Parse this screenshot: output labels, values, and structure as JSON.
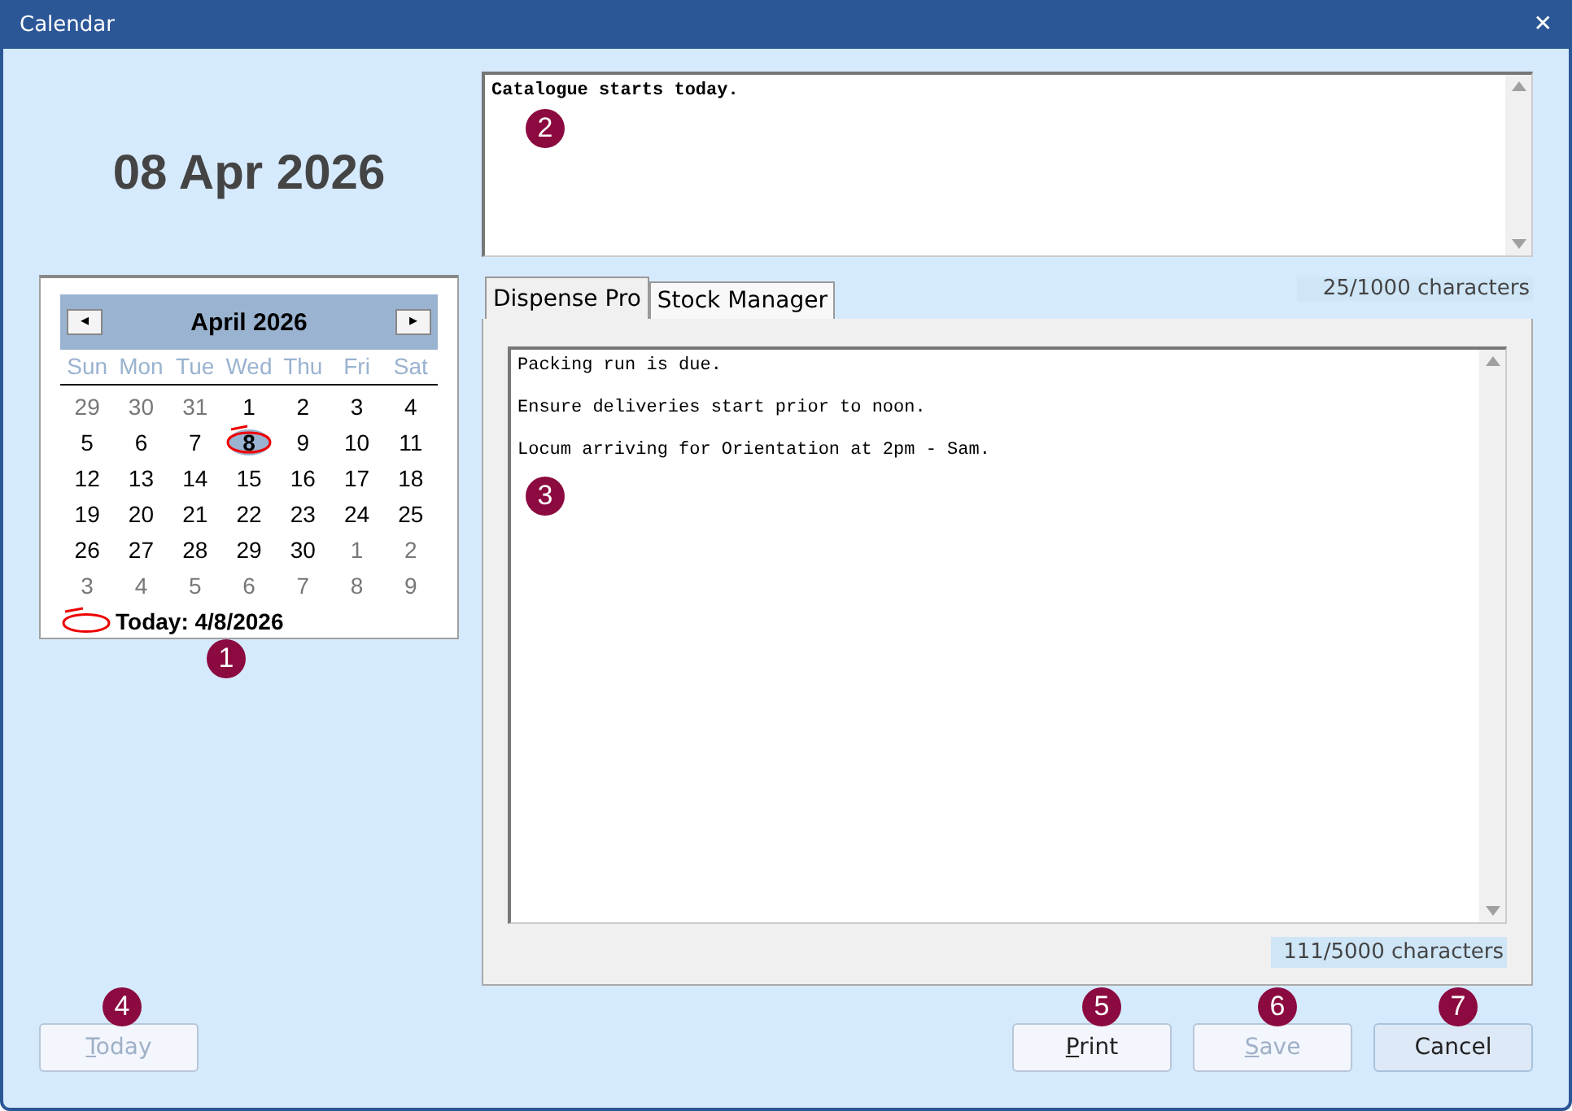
{
  "window": {
    "title": "Calendar",
    "close": "✕"
  },
  "date_heading": "08 Apr 2026",
  "calendar": {
    "month_label": "April 2026",
    "prev": "◂",
    "next": "▸",
    "weekdays": [
      "Sun",
      "Mon",
      "Tue",
      "Wed",
      "Thu",
      "Fri",
      "Sat"
    ],
    "weeks": [
      [
        {
          "day": "29",
          "other_month": true,
          "selected": false
        },
        {
          "day": "30",
          "other_month": true,
          "selected": false
        },
        {
          "day": "31",
          "other_month": true,
          "selected": false
        },
        {
          "day": "1",
          "other_month": false,
          "selected": false
        },
        {
          "day": "2",
          "other_month": false,
          "selected": false
        },
        {
          "day": "3",
          "other_month": false,
          "selected": false
        },
        {
          "day": "4",
          "other_month": false,
          "selected": false
        }
      ],
      [
        {
          "day": "5",
          "other_month": false,
          "selected": false
        },
        {
          "day": "6",
          "other_month": false,
          "selected": false
        },
        {
          "day": "7",
          "other_month": false,
          "selected": false
        },
        {
          "day": "8",
          "other_month": false,
          "selected": true
        },
        {
          "day": "9",
          "other_month": false,
          "selected": false
        },
        {
          "day": "10",
          "other_month": false,
          "selected": false
        },
        {
          "day": "11",
          "other_month": false,
          "selected": false
        }
      ],
      [
        {
          "day": "12",
          "other_month": false,
          "selected": false
        },
        {
          "day": "13",
          "other_month": false,
          "selected": false
        },
        {
          "day": "14",
          "other_month": false,
          "selected": false
        },
        {
          "day": "15",
          "other_month": false,
          "selected": false
        },
        {
          "day": "16",
          "other_month": false,
          "selected": false
        },
        {
          "day": "17",
          "other_month": false,
          "selected": false
        },
        {
          "day": "18",
          "other_month": false,
          "selected": false
        }
      ],
      [
        {
          "day": "19",
          "other_month": false,
          "selected": false
        },
        {
          "day": "20",
          "other_month": false,
          "selected": false
        },
        {
          "day": "21",
          "other_month": false,
          "selected": false
        },
        {
          "day": "22",
          "other_month": false,
          "selected": false
        },
        {
          "day": "23",
          "other_month": false,
          "selected": false
        },
        {
          "day": "24",
          "other_month": false,
          "selected": false
        },
        {
          "day": "25",
          "other_month": false,
          "selected": false
        }
      ],
      [
        {
          "day": "26",
          "other_month": false,
          "selected": false
        },
        {
          "day": "27",
          "other_month": false,
          "selected": false
        },
        {
          "day": "28",
          "other_month": false,
          "selected": false
        },
        {
          "day": "29",
          "other_month": false,
          "selected": false
        },
        {
          "day": "30",
          "other_month": false,
          "selected": false
        },
        {
          "day": "1",
          "other_month": true,
          "selected": false
        },
        {
          "day": "2",
          "other_month": true,
          "selected": false
        }
      ],
      [
        {
          "day": "3",
          "other_month": true,
          "selected": false
        },
        {
          "day": "4",
          "other_month": true,
          "selected": false
        },
        {
          "day": "5",
          "other_month": true,
          "selected": false
        },
        {
          "day": "6",
          "other_month": true,
          "selected": false
        },
        {
          "day": "7",
          "other_month": true,
          "selected": false
        },
        {
          "day": "8",
          "other_month": true,
          "selected": false
        },
        {
          "day": "9",
          "other_month": true,
          "selected": false
        }
      ]
    ],
    "today_label": "Today: 4/8/2026"
  },
  "general_note": {
    "text": "Catalogue starts today.",
    "counter": "25/1000 characters"
  },
  "tabs": [
    {
      "label": "Dispense Pro",
      "selected": true
    },
    {
      "label": "Stock Manager",
      "selected": false
    }
  ],
  "tab_note": {
    "lines": [
      "Packing run is due.",
      "Ensure deliveries start prior to noon.",
      "Locum arriving for Orientation at 2pm - Sam."
    ],
    "counter": "111/5000 characters"
  },
  "buttons": [
    {
      "label": "Today",
      "kind": "left",
      "disabled": true,
      "default": false,
      "mnemonic": true
    },
    {
      "label": "Print",
      "kind": "right",
      "disabled": false,
      "default": false,
      "mnemonic": true
    },
    {
      "label": "Save",
      "kind": "right",
      "disabled": true,
      "default": false,
      "mnemonic": true
    },
    {
      "label": "Cancel",
      "kind": "right",
      "disabled": false,
      "default": true,
      "mnemonic": false
    }
  ],
  "callouts": [
    "1",
    "2",
    "3",
    "4",
    "5",
    "6",
    "7"
  ]
}
